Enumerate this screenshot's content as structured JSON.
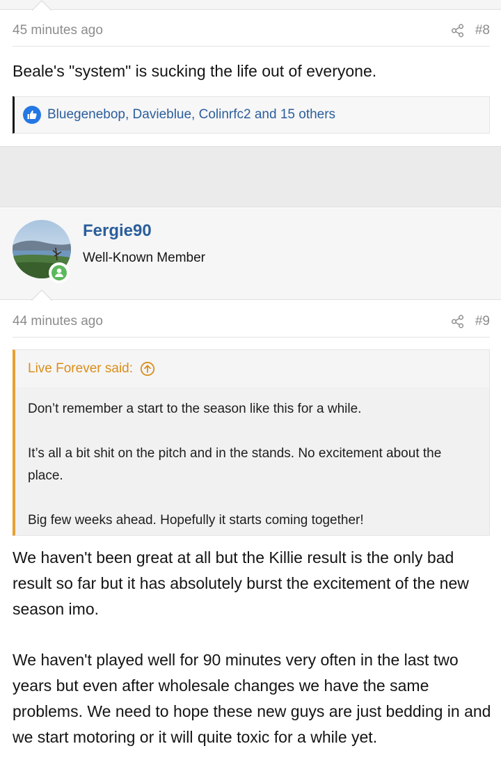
{
  "post8": {
    "time": "45 minutes ago",
    "number": "#8",
    "text": "Beale's \"system\" is sucking the life out of everyone.",
    "reactions": "Bluegenebop, Davieblue, Colinrfc2 and 15 others"
  },
  "user": {
    "name": "Fergie90",
    "title": "Well-Known Member"
  },
  "post9": {
    "time": "44 minutes ago",
    "number": "#9",
    "quote": {
      "author": "Live Forever said:",
      "paragraphs": [
        "Don’t remember a start to the season like this for a while.",
        "It’s all a bit shit on the pitch and in the stands. No excitement about the place.",
        "Big few weeks ahead. Hopefully it starts coming together!"
      ]
    },
    "paragraphs": [
      "We haven't been great at all but the Killie result is the only bad result so far but it has absolutely burst the excitement of the new season imo.",
      "We haven't played well for 90 minutes very often in the last two years but even after wholesale changes we have the same problems. We need to hope these new guys are just bedding in and we start motoring or it will quite toxic for a while yet."
    ]
  },
  "colors": {
    "link": "#2b5e9b",
    "quote_accent": "#e8a032",
    "like": "#2577e3",
    "online": "#5cb85c"
  }
}
